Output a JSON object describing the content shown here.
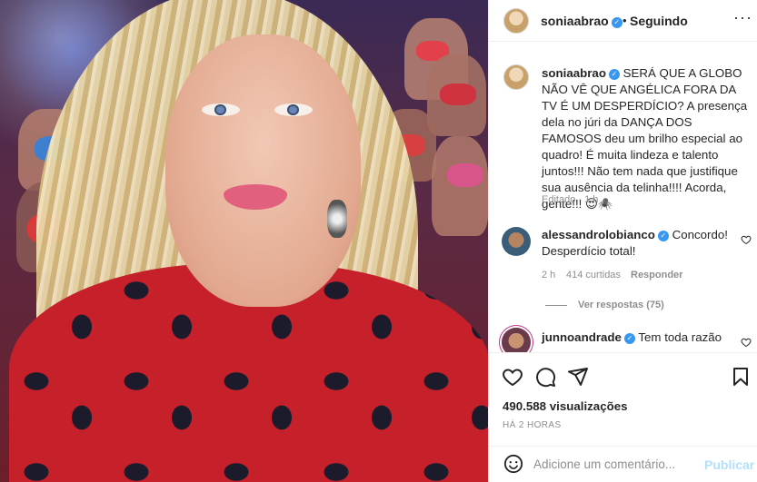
{
  "media": {
    "alt": ""
  },
  "header": {
    "username": "soniaabrao",
    "separator": "•",
    "follow_status": "Seguindo",
    "more": "···"
  },
  "caption": {
    "username": "soniaabrao",
    "text": "SERÁ QUE A GLOBO NÃO VÊ QUE ANGÉLICA FORA DA TV É UM DESPERDÍCIO? A presença dela no júri da DANÇA DOS FAMOSOS deu um brilho especial ao quadro! É muita lindeza e talento juntos!!! Não tem nada que justifique sua ausência da telinha!!!! Acorda, gente!!! 😍🕷️",
    "meta": "Editado · 1 h"
  },
  "comments": [
    {
      "username": "alessandrolobianco",
      "text": "Concordo! Desperdício total!",
      "time": "2 h",
      "likes": "414 curtidas",
      "reply": "Responder",
      "view_replies": "Ver respostas (75)"
    },
    {
      "username": "junnoandrade",
      "text": "Tem toda razão"
    }
  ],
  "actions": {
    "views": "490.588 visualizações",
    "time": "HÁ 2 HORAS"
  },
  "composer": {
    "placeholder": "Adicione um comentário...",
    "post_label": "Publicar"
  }
}
